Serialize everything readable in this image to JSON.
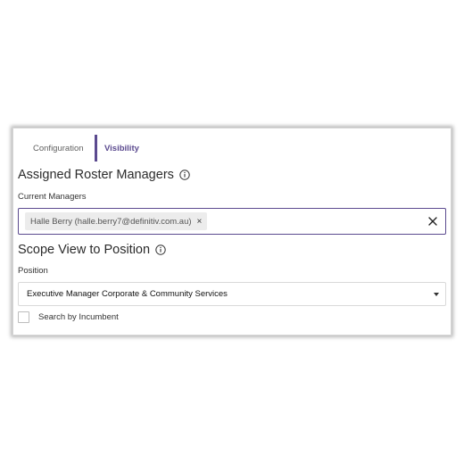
{
  "tabs": [
    {
      "label": "Configuration"
    },
    {
      "label": "Visibility",
      "active": true
    }
  ],
  "assigned_section": {
    "title": "Assigned Roster Managers",
    "info_icon": "info-icon",
    "current_managers_label": "Current Managers",
    "chips": [
      {
        "label": "Halle Berry (halle.berry7@definitiv.com.au)",
        "remove_icon": "×"
      }
    ],
    "clear_icon": "close-icon"
  },
  "scope_section": {
    "title": "Scope View to Position",
    "info_icon": "info-icon",
    "position_label": "Position",
    "position_value": "Executive Manager Corporate & Community Services",
    "search_by_incumbent_label": "Search by Incumbent",
    "search_by_incumbent_checked": false
  },
  "colors": {
    "accent": "#5b4a8f",
    "chip_bg": "#ececec",
    "border": "#d9d9d9"
  }
}
